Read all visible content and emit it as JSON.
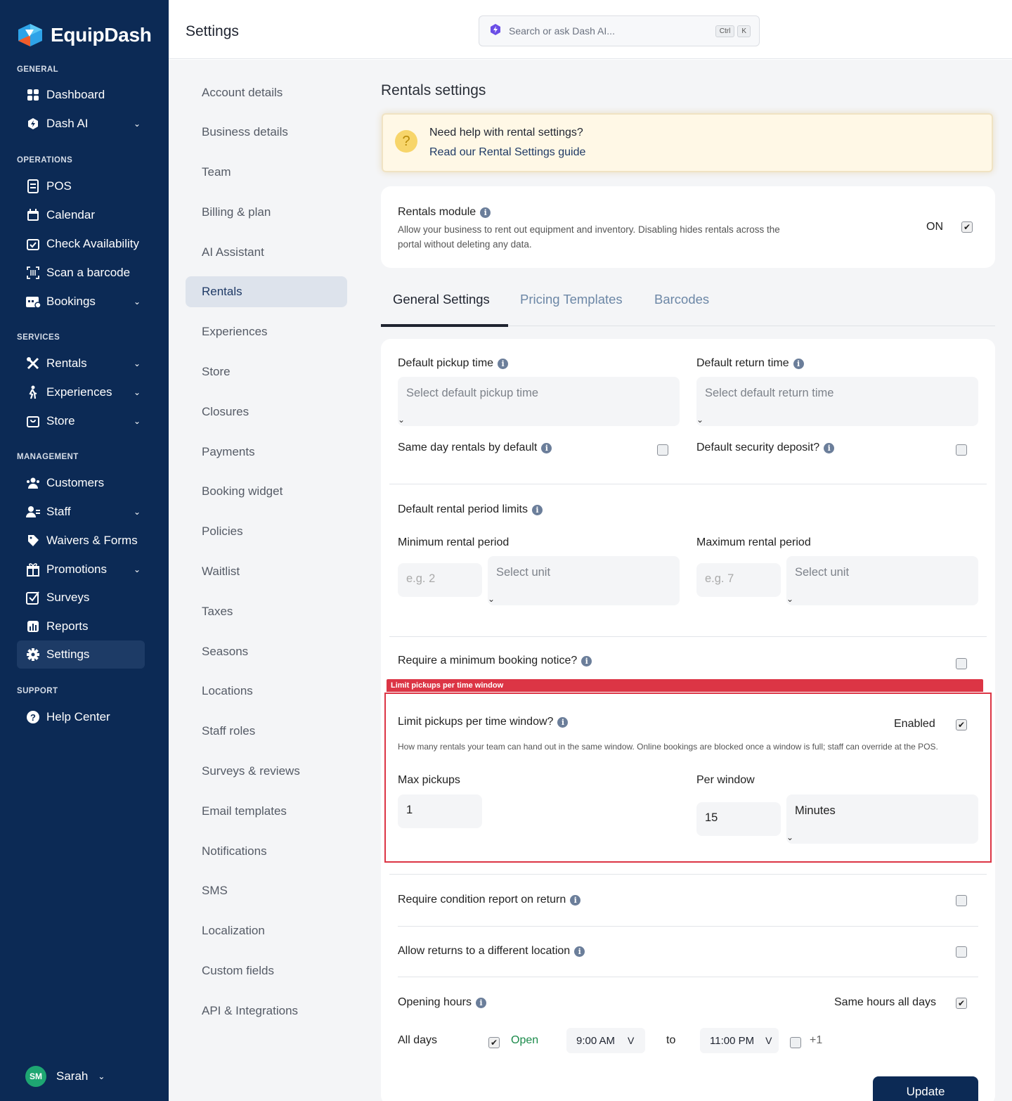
{
  "brand": {
    "name": "EquipDash"
  },
  "sidebar": {
    "sections": [
      "GENERAL",
      "OPERATIONS",
      "SERVICES",
      "MANAGEMENT",
      "SUPPORT"
    ],
    "items": [
      {
        "label": "Dashboard",
        "icon": "grid-icon"
      },
      {
        "label": "Dash AI",
        "icon": "hexagon-bolt-icon"
      },
      {
        "label": "POS",
        "icon": "receipt-icon"
      },
      {
        "label": "Calendar",
        "icon": "calendar-icon"
      },
      {
        "label": "Check Availability",
        "icon": "calendar-check-icon"
      },
      {
        "label": "Scan a barcode",
        "icon": "barcode-scan-icon"
      },
      {
        "label": "Bookings",
        "icon": "calendar-grid-icon"
      },
      {
        "label": "Rentals",
        "icon": "tools-icon"
      },
      {
        "label": "Experiences",
        "icon": "hiker-icon"
      },
      {
        "label": "Store",
        "icon": "bag-icon"
      },
      {
        "label": "Customers",
        "icon": "users-icon"
      },
      {
        "label": "Staff",
        "icon": "staff-icon"
      },
      {
        "label": "Waivers & Forms",
        "icon": "tag-icon"
      },
      {
        "label": "Promotions",
        "icon": "gift-icon"
      },
      {
        "label": "Surveys",
        "icon": "checkbox-icon"
      },
      {
        "label": "Reports",
        "icon": "chart-icon"
      },
      {
        "label": "Settings",
        "icon": "gear-icon"
      },
      {
        "label": "Help Center",
        "icon": "question-icon"
      }
    ],
    "user": {
      "initials": "SM",
      "name": "Sarah"
    }
  },
  "topbar": {
    "title": "Settings",
    "search_placeholder": "Search or ask Dash AI...",
    "kbd1": "Ctrl",
    "kbd2": "K"
  },
  "settings_nav": [
    "Account details",
    "Business details",
    "Team",
    "Billing & plan",
    "AI Assistant",
    "Rentals",
    "Experiences",
    "Store",
    "Closures",
    "Payments",
    "Booking widget",
    "Policies",
    "Waitlist",
    "Taxes",
    "Seasons",
    "Locations",
    "Staff roles",
    "Surveys & reviews",
    "Email templates",
    "Notifications",
    "SMS",
    "Localization",
    "Custom fields",
    "API & Integrations"
  ],
  "main": {
    "title": "Rentals settings",
    "help": {
      "text": "Need help with rental settings?",
      "link": "Read our Rental Settings guide"
    },
    "module": {
      "label": "Rentals module",
      "desc": "Allow your business to rent out equipment and inventory. Disabling hides rentals across the portal without deleting any data.",
      "state": "ON"
    },
    "tabs": [
      "General Settings",
      "Pricing Templates",
      "Barcodes"
    ],
    "pickup": {
      "label": "Default pickup time",
      "placeholder": "Select default pickup time"
    },
    "return": {
      "label": "Default return time",
      "placeholder": "Select default return time"
    },
    "same_day": "Same day rentals by default",
    "deposit": "Default security deposit?",
    "limits": {
      "label": "Default rental period limits",
      "min_label": "Minimum rental period",
      "max_label": "Maximum rental period",
      "min_placeholder": "e.g. 2",
      "max_placeholder": "e.g. 7",
      "unit_placeholder": "Select unit"
    },
    "notice": "Require a minimum booking notice?",
    "highlight_label": "Limit pickups per time window",
    "limit": {
      "label": "Limit pickups per time window?",
      "enabled": "Enabled",
      "desc": "How many rentals your team can hand out in the same window. Online bookings are blocked once a window is full; staff can override at the POS.",
      "max_label": "Max pickups",
      "max_value": "1",
      "per_label": "Per window",
      "per_value": "15",
      "per_unit": "Minutes"
    },
    "condition": "Require condition report on return",
    "returns": "Allow returns to a different location",
    "hours": {
      "label": "Opening hours",
      "same": "Same hours all days",
      "day": "All days",
      "open": "Open",
      "from": "9:00 AM",
      "to_word": "to",
      "to": "11:00 PM",
      "plus": "+1"
    },
    "update": "Update"
  },
  "colors": {
    "sidebar": "#0c2a55",
    "accent": "#1f3a66",
    "highlight": "#dc3545",
    "open": "#1a8a4a"
  }
}
